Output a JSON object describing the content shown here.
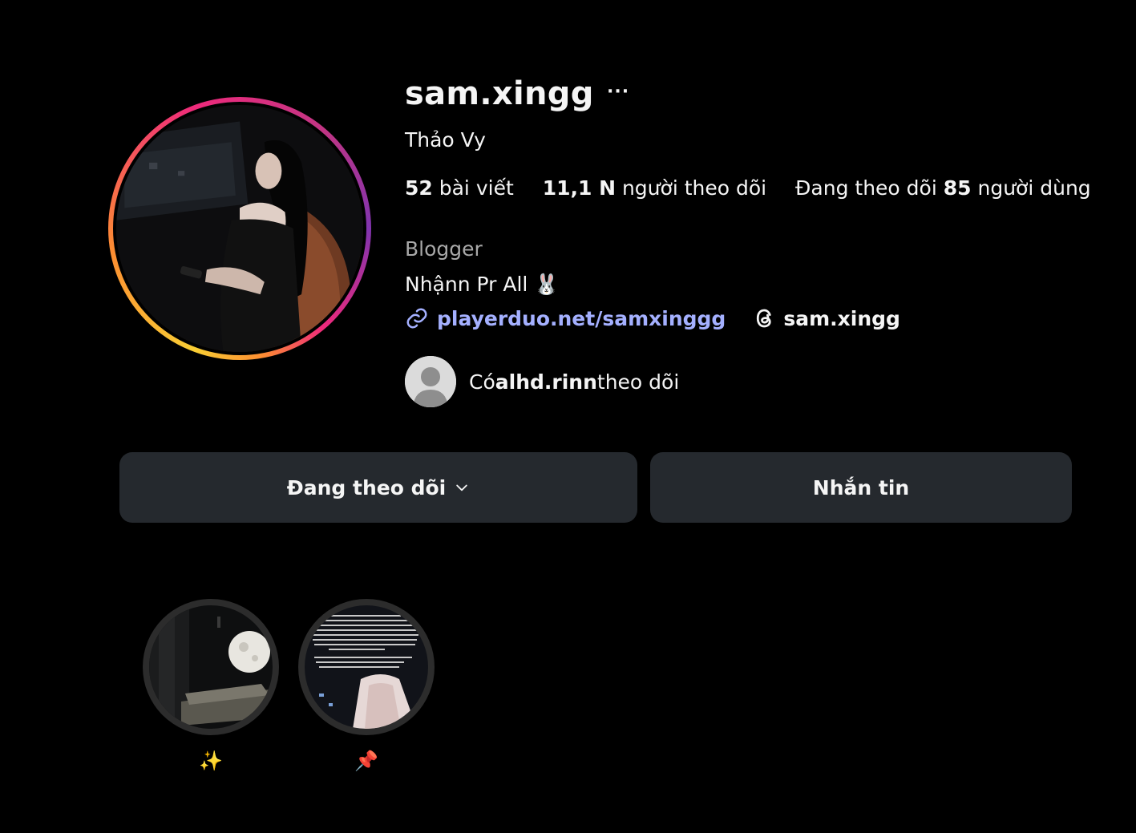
{
  "profile": {
    "username": "sam.xingg",
    "more_label": "···",
    "full_name": "Thảo Vy",
    "stats": {
      "posts_count": "52",
      "posts_label": " bài viết",
      "followers_count": "11,1 N",
      "followers_label": " người theo dõi",
      "following_prefix": "Đang theo dõi ",
      "following_count": "85",
      "following_label": " người dùng"
    },
    "category": "Blogger",
    "bio": "Nhậnn Pr All 🐰",
    "external_link": "playerduo.net/samxinggg",
    "threads_handle": "sam.xingg",
    "followed_by": {
      "prefix": "Có ",
      "user": "alhd.rinn",
      "suffix": " theo dõi"
    }
  },
  "actions": {
    "following_label": "Đang theo dõi",
    "message_label": "Nhắn tin"
  },
  "highlights": [
    {
      "label": "✨"
    },
    {
      "label": "📌"
    }
  ],
  "colors": {
    "background": "#000000",
    "button_bg": "#25292e",
    "link": "#a4b0ff",
    "secondary_text": "#a8a8a8"
  }
}
